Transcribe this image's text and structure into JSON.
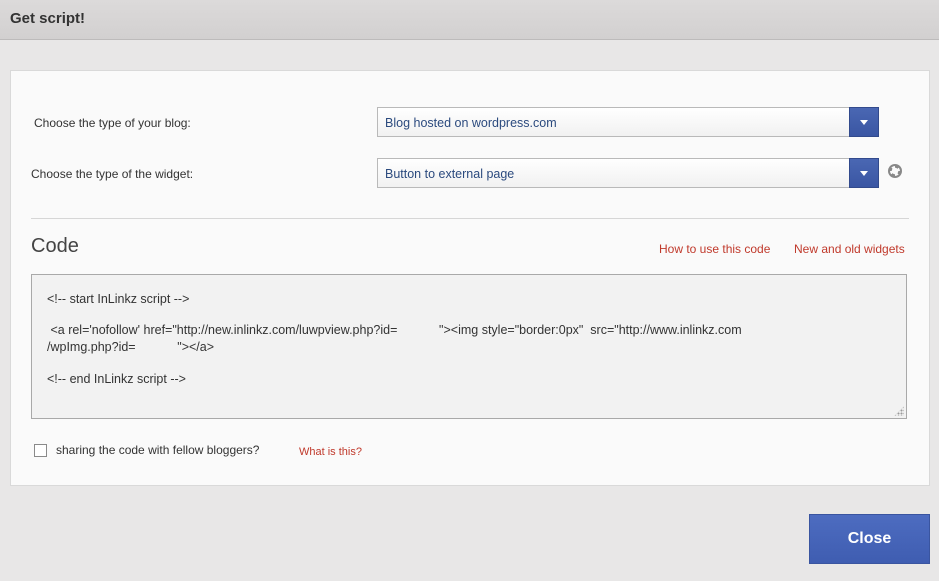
{
  "window": {
    "title": "Get script!"
  },
  "form": {
    "blog_type_label": "Choose the type of your blog:",
    "blog_type_value": "Blog hosted on wordpress.com",
    "widget_type_label": "Choose the type of the widget:",
    "widget_type_value": "Button to external page"
  },
  "code": {
    "heading": "Code",
    "how_to_link": "How to use this code",
    "widgets_link": "New and old widgets",
    "line1": "<!-- start InLinkz script -->",
    "line2": " <a rel='nofollow' href=\"http://new.inlinkz.com/luwpview.php?id=            \"><img style=\"border:0px\"  src=\"http://www.inlinkz.com",
    "line3": "/wpImg.php?id=            \"></a>",
    "line4": "<!-- end InLinkz script -->"
  },
  "sharing": {
    "label": "sharing the code with fellow bloggers?",
    "what_link": "What is this?",
    "checked": false
  },
  "footer": {
    "close_label": "Close"
  },
  "colors": {
    "accent": "#4562b5",
    "link": "#c0392b"
  }
}
